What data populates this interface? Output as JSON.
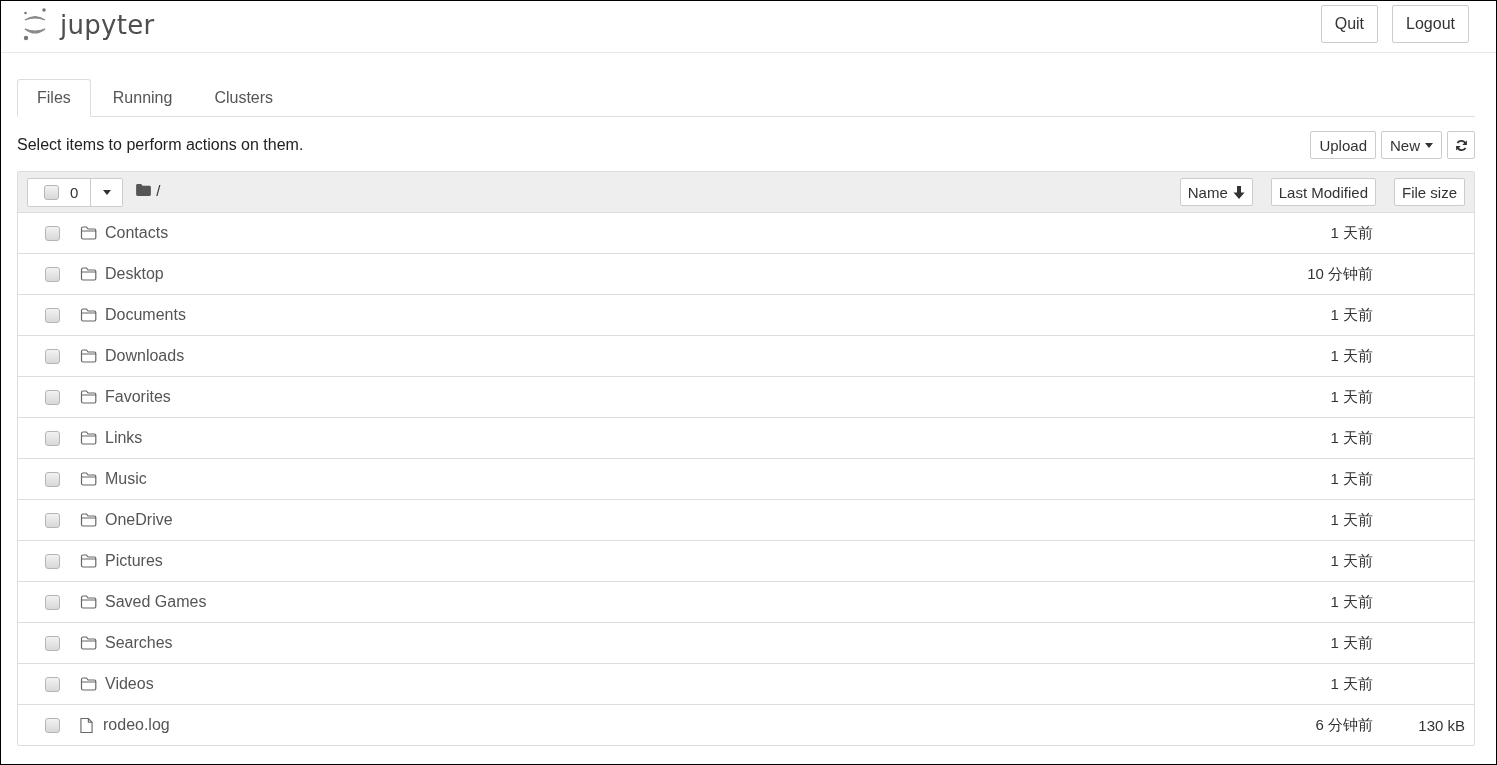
{
  "header": {
    "logo": "jupyter",
    "buttons": [
      "Quit",
      "Logout"
    ]
  },
  "tabs": [
    {
      "label": "Files",
      "selected": true
    },
    {
      "label": "Running",
      "selected": false
    },
    {
      "label": "Clusters",
      "selected": false
    }
  ],
  "toolbar": {
    "hint": "Select items to perform actions on them.",
    "upload": "Upload",
    "new": "New"
  },
  "list_header": {
    "checked": false,
    "selected_count": "0",
    "path": "/",
    "sort_buttons": [
      {
        "label": "Name",
        "sorted": true
      },
      {
        "label": "Last Modified",
        "sorted": false
      },
      {
        "label": "File size",
        "sorted": false
      }
    ]
  },
  "rows": [
    {
      "kind": "folder",
      "name": "Contacts",
      "modified": "1 天前",
      "checked": false
    },
    {
      "kind": "folder",
      "name": "Desktop",
      "modified": "10 分钟前",
      "checked": false
    },
    {
      "kind": "folder",
      "name": "Documents",
      "modified": "1 天前",
      "checked": false
    },
    {
      "kind": "folder",
      "name": "Downloads",
      "modified": "1 天前",
      "checked": false
    },
    {
      "kind": "folder",
      "name": "Favorites",
      "modified": "1 天前",
      "checked": false
    },
    {
      "kind": "folder",
      "name": "Links",
      "modified": "1 天前",
      "checked": false
    },
    {
      "kind": "folder",
      "name": "Music",
      "modified": "1 天前",
      "checked": false
    },
    {
      "kind": "folder",
      "name": "OneDrive",
      "modified": "1 天前",
      "checked": false
    },
    {
      "kind": "folder",
      "name": "Pictures",
      "modified": "1 天前",
      "checked": false
    },
    {
      "kind": "folder",
      "name": "Saved Games",
      "modified": "1 天前",
      "checked": false
    },
    {
      "kind": "folder",
      "name": "Searches",
      "modified": "1 天前",
      "checked": false
    },
    {
      "kind": "folder",
      "name": "Videos",
      "modified": "1 天前",
      "checked": false
    },
    {
      "kind": "file",
      "name": "rodeo.log",
      "modified": "6 分钟前",
      "size": "130 kB",
      "checked": false
    }
  ]
}
